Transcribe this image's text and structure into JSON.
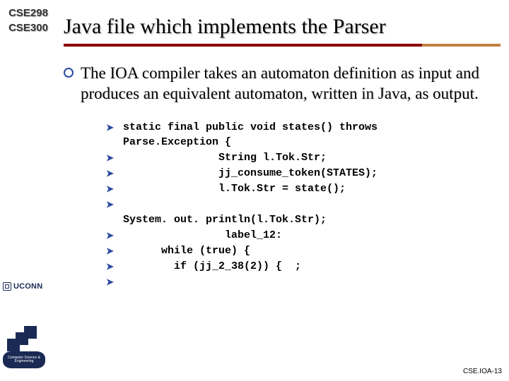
{
  "sidebar": {
    "courses": [
      "CSE298",
      "CSE300"
    ],
    "uconn": "UCONN"
  },
  "header": {
    "title": "Java file which implements the Parser"
  },
  "bullet": {
    "text": "The IOA compiler takes an automaton definition as input and produces an equivalent automaton, written in Java, as output."
  },
  "code": {
    "lines": [
      "static final public void states() throws\nParse.Exception {",
      "               String l.Tok.Str;",
      "               jj_consume_token(STATES);",
      "               l.Tok.Str = state();",
      "\nSystem. out. println(l.Tok.Str);",
      "                label_12:",
      "      while (true) {",
      "        if (jj_2_38(2)) {  ;",
      ""
    ]
  },
  "footer": {
    "text": "CSE.IOA-13"
  }
}
